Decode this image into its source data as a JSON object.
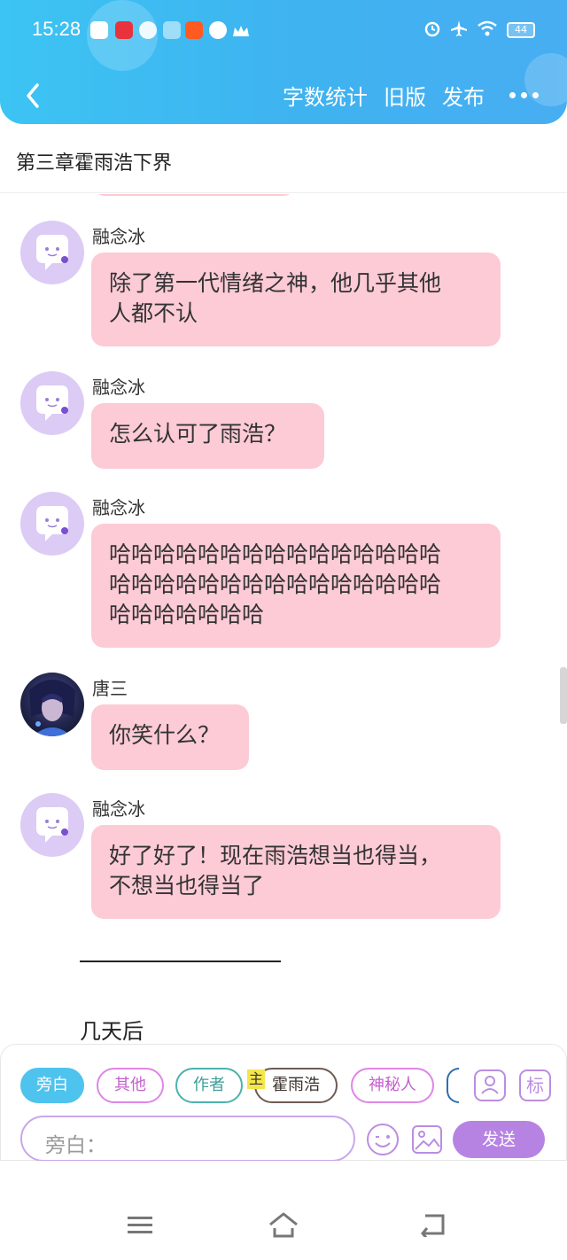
{
  "status_bar": {
    "time": "15:28",
    "battery": "44",
    "icons": [
      "music-icon",
      "xiaohongshu-icon",
      "wechat-icon",
      "app-icon",
      "taobao-icon",
      "compass-icon",
      "crown-icon",
      "alarm-icon",
      "airplane-icon",
      "wifi-icon",
      "battery-icon"
    ]
  },
  "nav": {
    "back_icon": "chevron-left-icon",
    "word_count": "字数统计",
    "old_version": "旧版",
    "publish": "发布",
    "more_icon": "more-dots-icon"
  },
  "chapter": {
    "title": "第三章霍雨浩下界"
  },
  "messages": [
    {
      "sender": "融念冰",
      "avatar": "ice-avatar",
      "line1": "除了第一代情绪之神，他几乎其他",
      "line2": "人都不认"
    },
    {
      "sender": "融念冰",
      "avatar": "ice-avatar",
      "line1": "怎么认可了雨浩？"
    },
    {
      "sender": "融念冰",
      "avatar": "ice-avatar",
      "line1": "哈哈哈哈哈哈哈哈哈哈哈哈哈哈哈",
      "line2": "哈哈哈哈哈哈哈哈哈哈哈哈哈哈哈",
      "line3": "哈哈哈哈哈哈哈"
    },
    {
      "sender": "唐三",
      "avatar": "tang-san-avatar",
      "line1": "你笑什么？"
    },
    {
      "sender": "融念冰",
      "avatar": "ice-avatar",
      "line1": "好了好了！现在雨浩想当也得当，",
      "line2": "不想当也得当了"
    }
  ],
  "narration": "几天后",
  "input_panel": {
    "roles": {
      "narrator": "旁白",
      "other": "其他",
      "author": "作者",
      "main_badge": "主",
      "huo_yuhao": "霍雨浩",
      "mystery": "神秘人"
    },
    "tag_icon": "标",
    "input_placeholder": "旁白：",
    "send": "发送",
    "colors": {
      "narrator_active": "#4ec3ee",
      "send": "#b783e3",
      "bubble": "#fccbd6"
    }
  },
  "system_nav": {
    "icons": [
      "menu-icon",
      "home-icon",
      "back-icon"
    ]
  }
}
